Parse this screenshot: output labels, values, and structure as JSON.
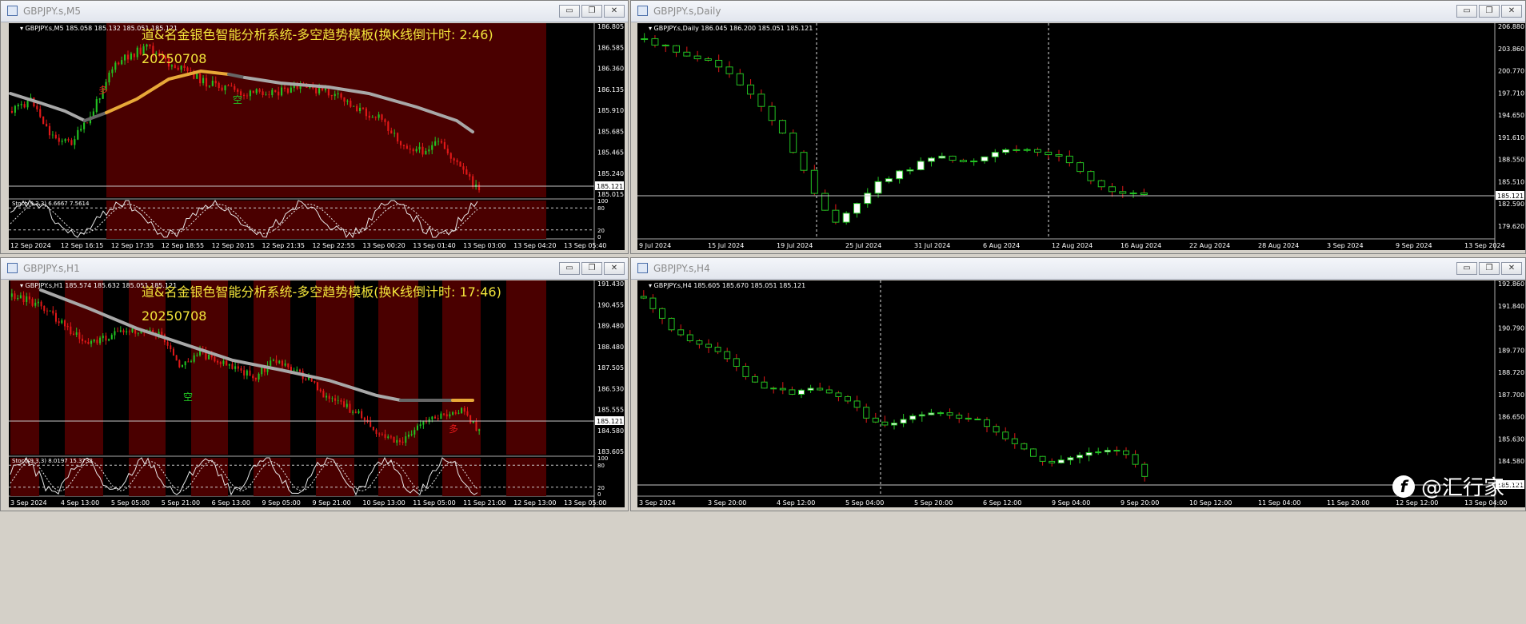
{
  "windows": {
    "m5": {
      "title": "GBPJPY.s,M5",
      "info": "GBPJPY.s,M5  185.058 185.132 185.051 185.121",
      "overlay_title": "道&名金银色智能分析系统-多空趋势模板(换K线倒计时: 2:46)",
      "overlay_date": "20250708",
      "signal_long": "多",
      "signal_short": "空",
      "price_labels": [
        "186.805",
        "186.585",
        "186.360",
        "186.135",
        "185.910",
        "185.685",
        "185.465",
        "185.240",
        "185.015"
      ],
      "current_price": "185.121",
      "stoch_label": "Stoch(9,3,3) 6.6667 7.5614",
      "stoch_levels": [
        "100",
        "80",
        "20",
        "0"
      ],
      "time_labels": [
        "12 Sep 2024",
        "12 Sep 16:15",
        "12 Sep 17:35",
        "12 Sep 18:55",
        "12 Sep 20:15",
        "12 Sep 21:35",
        "12 Sep 22:55",
        "13 Sep 00:20",
        "13 Sep 01:40",
        "13 Sep 03:00",
        "13 Sep 04:20",
        "13 Sep 05:40"
      ]
    },
    "daily": {
      "title": "GBPJPY.s,Daily",
      "info": "GBPJPY.s,Daily  186.045 186.200 185.051 185.121",
      "price_labels": [
        "206.880",
        "203.860",
        "200.770",
        "197.710",
        "194.650",
        "191.610",
        "188.550",
        "185.510",
        "182.590",
        "179.620"
      ],
      "current_price": "185.121",
      "time_labels": [
        "9 Jul 2024",
        "15 Jul 2024",
        "19 Jul 2024",
        "25 Jul 2024",
        "31 Jul 2024",
        "6 Aug 2024",
        "12 Aug 2024",
        "16 Aug 2024",
        "22 Aug 2024",
        "28 Aug 2024",
        "3 Sep 2024",
        "9 Sep 2024",
        "13 Sep 2024"
      ]
    },
    "h1": {
      "title": "GBPJPY.s,H1",
      "info": "GBPJPY.s,H1  185.574 185.632 185.051 185.121",
      "overlay_title": "道&名金银色智能分析系统-多空趋势模板(换K线倒计时: 17:46)",
      "overlay_date": "20250708",
      "signal_long": "多",
      "signal_short": "空",
      "price_labels": [
        "191.430",
        "190.455",
        "189.480",
        "188.480",
        "187.505",
        "186.530",
        "185.555",
        "184.580",
        "183.605"
      ],
      "current_price": "185.121",
      "stoch_label": "Stoch(9,3,3) 8.0197 15.3733",
      "stoch_levels": [
        "100",
        "80",
        "20",
        "0"
      ],
      "time_labels": [
        "3 Sep 2024",
        "4 Sep 13:00",
        "5 Sep 05:00",
        "5 Sep 21:00",
        "6 Sep 13:00",
        "9 Sep 05:00",
        "9 Sep 21:00",
        "10 Sep 13:00",
        "11 Sep 05:00",
        "11 Sep 21:00",
        "12 Sep 13:00",
        "13 Sep 05:00"
      ]
    },
    "h4": {
      "title": "GBPJPY.s,H4",
      "info": "GBPJPY.s,H4  185.605 185.670 185.051 185.121",
      "price_labels": [
        "192.860",
        "191.840",
        "190.790",
        "189.770",
        "188.720",
        "187.700",
        "186.650",
        "185.630",
        "184.580",
        "183.560"
      ],
      "current_price": "185.121",
      "time_labels": [
        "3 Sep 2024",
        "3 Sep 20:00",
        "4 Sep 12:00",
        "5 Sep 04:00",
        "5 Sep 20:00",
        "6 Sep 12:00",
        "9 Sep 04:00",
        "9 Sep 20:00",
        "10 Sep 12:00",
        "11 Sep 04:00",
        "11 Sep 20:00",
        "12 Sep 12:00",
        "13 Sep 04:00"
      ]
    }
  },
  "window_buttons": {
    "minimize": "▭",
    "maximize": "❐",
    "close": "✕"
  },
  "watermark": {
    "logo": "f",
    "text": "@汇行家"
  },
  "colors": {
    "bull": "#22c322",
    "bear": "#e01818",
    "panel_bg": "#4a0000",
    "ma_gray": "#a8a8a8",
    "ma_gold": "#e8a838",
    "overlay_text": "#f2e43a"
  }
}
